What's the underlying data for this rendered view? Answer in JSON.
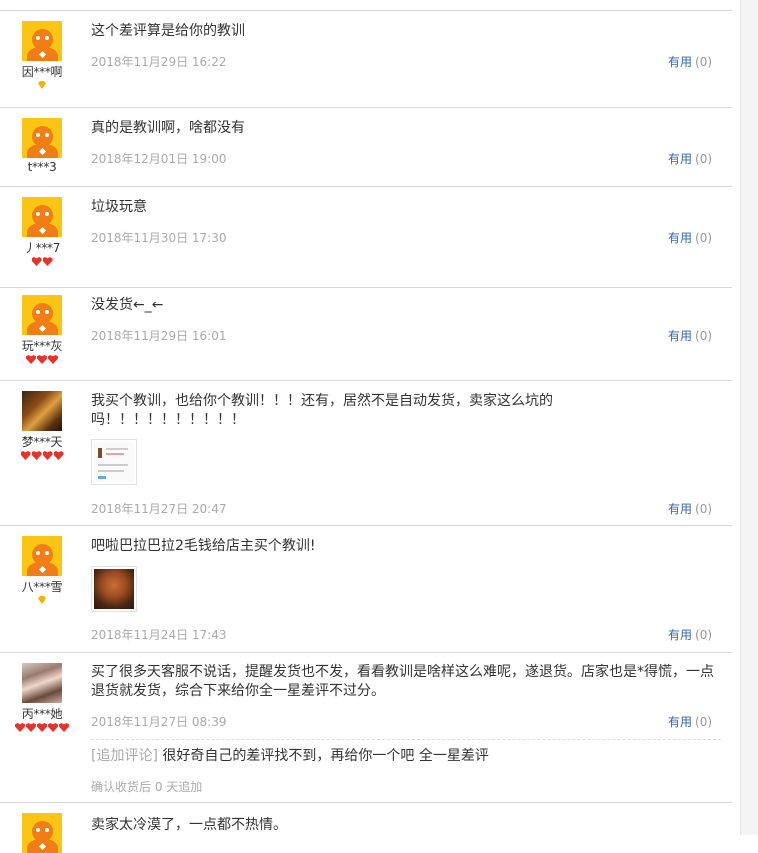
{
  "reviews": [
    {
      "nickname": "因***啊",
      "avatar": "default-avatar",
      "badges": [
        "diamond"
      ],
      "content": "这个差评算是给你的教训",
      "date": "2018年11月29日 16:22",
      "useful_label": "有用",
      "useful_count": "(0)"
    },
    {
      "nickname": "t***3",
      "avatar": "default-avatar",
      "badges": [],
      "content": "真的是教训啊，啥都没有",
      "date": "2018年12月01日 19:00",
      "useful_label": "有用",
      "useful_count": "(0)"
    },
    {
      "nickname": "丿***7",
      "avatar": "default-avatar",
      "badges": [
        "heart",
        "heart"
      ],
      "content": "垃圾玩意",
      "date": "2018年11月30日 17:30",
      "useful_label": "有用",
      "useful_count": "(0)"
    },
    {
      "nickname": "玩***灰",
      "avatar": "default-avatar",
      "badges": [
        "heart",
        "heart",
        "heart"
      ],
      "content": "没发货←_←",
      "date": "2018年11月29日 16:01",
      "useful_label": "有用",
      "useful_count": "(0)"
    },
    {
      "nickname": "梦***天",
      "avatar": "photo-avatar",
      "badges": [
        "heart",
        "heart",
        "heart",
        "heart"
      ],
      "content": "我买个教训，也给你个教训！！！还有，居然不是自动发货，卖家这么坑的吗！！！！！！！！！！",
      "date": "2018年11月27日 20:47",
      "useful_label": "有用",
      "useful_count": "(0)",
      "has_image": true
    },
    {
      "nickname": "八***雪",
      "avatar": "default-avatar",
      "badges": [
        "diamond"
      ],
      "content": "吧啦巴拉巴拉2毛钱给店主买个教训!",
      "date": "2018年11月24日 17:43",
      "useful_label": "有用",
      "useful_count": "(0)",
      "has_image": true
    },
    {
      "nickname": "丙***她",
      "avatar": "photo-avatar",
      "badges": [
        "heart",
        "heart",
        "heart",
        "heart",
        "heart"
      ],
      "content": "买了很多天客服不说话，提醒发货也不发，看看教训是啥样这么难呢，遂退货。店家也是*得慌，一点退货就发货，综合下来给你全一星差评不过分。",
      "date": "2018年11月27日 08:39",
      "useful_label": "有用",
      "useful_count": "(0)",
      "append_tag": "[追加评论]",
      "append_text": "很好奇自己的差评找不到，再给你一个吧 全一星差评",
      "append_meta": "确认收货后 0 天追加"
    },
    {
      "nickname": "",
      "avatar": "default-avatar",
      "badges": [],
      "content": "卖家太冷漠了，一点都不热情。"
    }
  ]
}
